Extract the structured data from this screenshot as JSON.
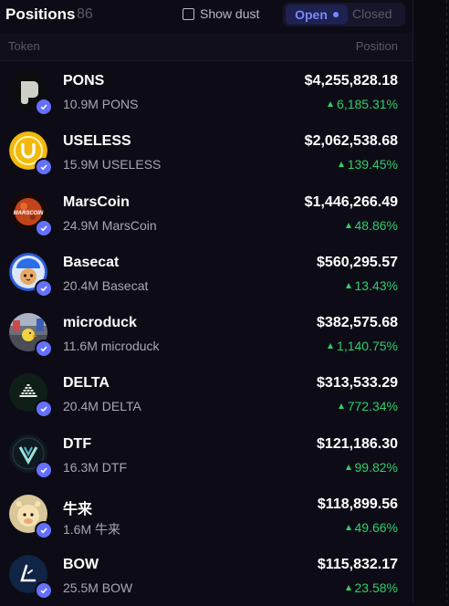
{
  "header": {
    "title": "Positions",
    "count": "86",
    "show_dust_label": "Show dust",
    "tab_open": "Open",
    "tab_closed": "Closed"
  },
  "columns": {
    "token": "Token",
    "position": "Position"
  },
  "colors": {
    "accent": "#7b86ff",
    "positive": "#2ecf6a",
    "verified": "#6670ff"
  },
  "positions": [
    {
      "name": "PONS",
      "amount": "10.9M PONS",
      "value": "$4,255,828.18",
      "change": "6,185.31%",
      "icon": "pons-icon"
    },
    {
      "name": "USELESS",
      "amount": "15.9M USELESS",
      "value": "$2,062,538.68",
      "change": "139.45%",
      "icon": "useless-coin-icon"
    },
    {
      "name": "MarsCoin",
      "amount": "24.9M MarsCoin",
      "value": "$1,446,266.49",
      "change": "48.86%",
      "icon": "marscoin-icon",
      "logo_text": "MARSCOIN"
    },
    {
      "name": "Basecat",
      "amount": "20.4M Basecat",
      "value": "$560,295.57",
      "change": "13.43%",
      "icon": "basecat-icon"
    },
    {
      "name": "microduck",
      "amount": "11.6M microduck",
      "value": "$382,575.68",
      "change": "1,140.75%",
      "icon": "microduck-icon"
    },
    {
      "name": "DELTA",
      "amount": "20.4M DELTA",
      "value": "$313,533.29",
      "change": "772.34%",
      "icon": "delta-icon"
    },
    {
      "name": "DTF",
      "amount": "16.3M DTF",
      "value": "$121,186.30",
      "change": "99.82%",
      "icon": "dtf-icon"
    },
    {
      "name": "牛来",
      "amount": "1.6M 牛来",
      "value": "$118,899.56",
      "change": "49.66%",
      "icon": "niulai-icon"
    },
    {
      "name": "BOW",
      "amount": "25.5M BOW",
      "value": "$115,832.17",
      "change": "23.58%",
      "icon": "bow-icon"
    }
  ]
}
